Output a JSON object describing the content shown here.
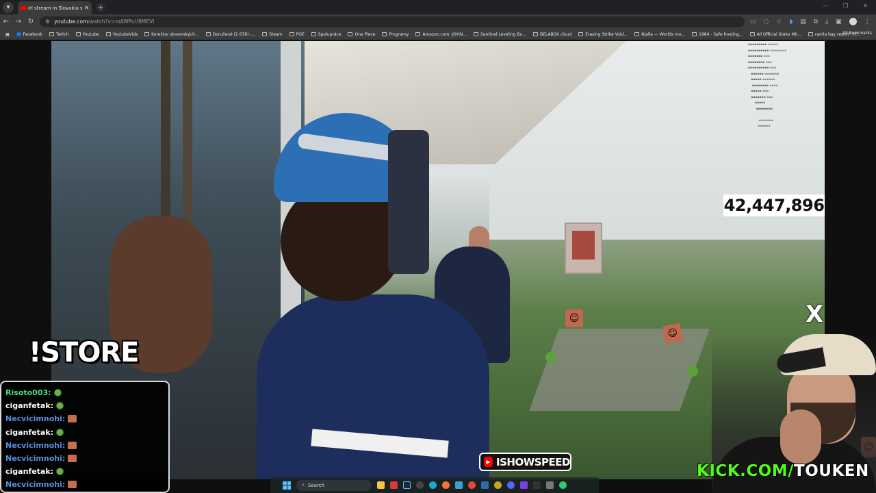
{
  "browser": {
    "tab_title": "irl stream in Slovakia sk - Y",
    "url_host": "youtube.com",
    "url_path": "/watch?v=mAWPoU9MEVI",
    "bookmarks": [
      {
        "label": "Facebook",
        "icon": "facebook-icon"
      },
      {
        "label": "Twitch",
        "icon": "twitch-icon"
      },
      {
        "label": "Youtube",
        "icon": "folder-icon"
      },
      {
        "label": "YoutubeVids",
        "icon": "folder-icon"
      },
      {
        "label": "Korektor slovenských...",
        "icon": "page-icon"
      },
      {
        "label": "Doručené (2 678) -...",
        "icon": "mail-icon"
      },
      {
        "label": "Steam",
        "icon": "folder-icon"
      },
      {
        "label": "POE",
        "icon": "folder-icon"
      },
      {
        "label": "Spolupráce",
        "icon": "folder-icon"
      },
      {
        "label": "One Piece",
        "icon": "folder-icon"
      },
      {
        "label": "Programy",
        "icon": "folder-icon"
      },
      {
        "label": "Amazon.com: JOYIN...",
        "icon": "amazon-icon"
      },
      {
        "label": "Sentinel Leveling Bu...",
        "icon": "page-icon"
      },
      {
        "label": "BELABOX cloud",
        "icon": "page-icon"
      },
      {
        "label": "Erasing Strike Void...",
        "icon": "page-icon"
      },
      {
        "label": "Njalla — Worlds mo...",
        "icon": "page-icon"
      },
      {
        "label": "1984 - Safe hosting...",
        "icon": "page-icon"
      },
      {
        "label": "All Official Stake Mir...",
        "icon": "page-icon"
      },
      {
        "label": "ramla bay resort - H...",
        "icon": "page-icon"
      }
    ],
    "all_bookmarks": "All Bookmarks"
  },
  "overlay": {
    "counter": "42,447,896",
    "store": "!STORE",
    "youtube_badge": "ISHOWSPEED",
    "kick_prefix": "KICK.COM/",
    "kick_name": "TOUKEN",
    "x_logo": "X"
  },
  "chat": [
    {
      "user": "Risoto003:",
      "color": "#43e07a",
      "emote": "green"
    },
    {
      "user": "ciganfetak:",
      "color": "#ffffff",
      "emote": "green"
    },
    {
      "user": "Necvicimnohi:",
      "color": "#5a8dde",
      "emote": "face"
    },
    {
      "user": "ciganfetak:",
      "color": "#ffffff",
      "emote": "green"
    },
    {
      "user": "Necvicimnohi:",
      "color": "#5a8dde",
      "emote": "face"
    },
    {
      "user": "Necvicimnohi:",
      "color": "#5a8dde",
      "emote": "face"
    },
    {
      "user": "ciganfetak:",
      "color": "#ffffff",
      "emote": "green"
    },
    {
      "user": "Necvicimnohi:",
      "color": "#5a8dde",
      "emote": "face"
    }
  ],
  "taskbar": {
    "search_label": "Search"
  }
}
